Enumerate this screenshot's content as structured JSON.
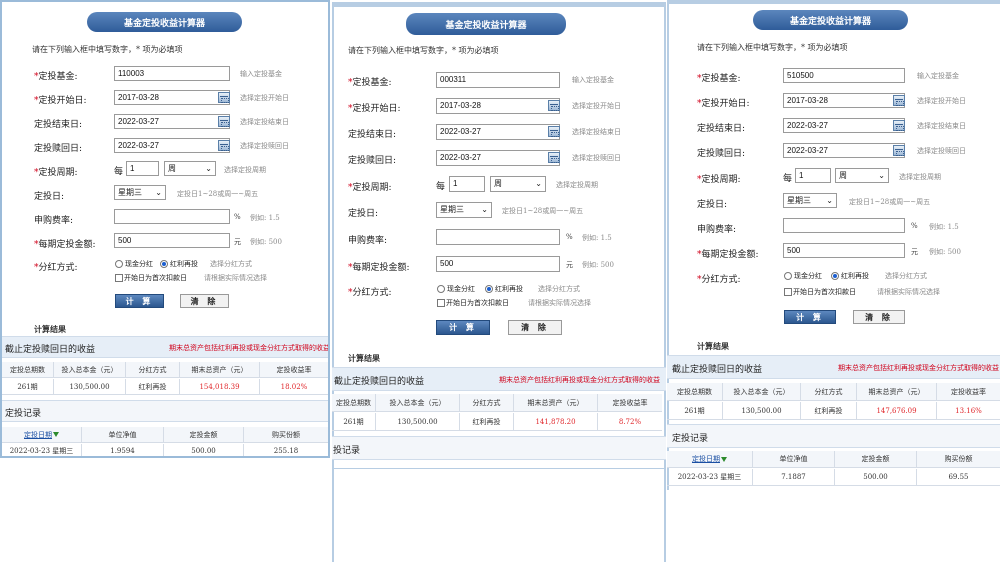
{
  "title": "基金定投收益计算器",
  "instruction": "请在下列输入框中填写数字，* 项为必填项",
  "labels": {
    "fund": "定投基金:",
    "start": "定投开始日:",
    "end": "定投结束日:",
    "redeem": "定投赎回日:",
    "period": "定投周期:",
    "day": "定投日:",
    "fee": "申购费率:",
    "amount": "每期定投金额:",
    "dividend": "分红方式:"
  },
  "hints": {
    "fund": "输入定投基金",
    "start": "选择定投开始日",
    "end": "选择定投结束日",
    "redeem": "选择定投赎回日",
    "period": "选择定投周期",
    "day": "定投日1~28或周一~周五",
    "fee": "例如: 1.5",
    "amount": "例如: 500",
    "dividend": "选择分红方式",
    "first_deduct": "请根据实际情况选择"
  },
  "units": {
    "fee": "%",
    "amount": "元"
  },
  "every": "每",
  "period_unit": "周",
  "weekday": "星期三",
  "radio_cash": "现金分红",
  "radio_reinvest": "红利再投",
  "first_deduct_label": "开始日为首次扣款日",
  "buttons": {
    "calc": "计 算",
    "clear": "清 除"
  },
  "result_title": "计算结果",
  "section_income": "截止定投赎回日的收益",
  "section_note": "期末总资产包括红利再投或现金分红方式取得的收益",
  "section_records": "定投记录",
  "summary_headers": [
    "定投总期数",
    "投入总本金（元）",
    "分红方式",
    "期末总资产（元）",
    "定投收益率"
  ],
  "record_headers": [
    "定投日期",
    "单位净值",
    "定投金额",
    "购买份额"
  ],
  "panels": [
    {
      "fund": "110003",
      "start": "2017-03-28",
      "end": "2022-03-27",
      "redeem": "2022-03-27",
      "period_num": "1",
      "amount": "500",
      "summary": [
        "261期",
        "130,500.00",
        "红利再投",
        "154,018.39",
        "18.02%"
      ],
      "record": [
        "2022-03-23 星期三",
        "1.9594",
        "500.00",
        "255.18"
      ]
    },
    {
      "fund": "000311",
      "start": "2017-03-28",
      "end": "2022-03-27",
      "redeem": "2022-03-27",
      "period_num": "1",
      "amount": "500",
      "summary": [
        "261期",
        "130,500.00",
        "红利再投",
        "141,878.20",
        "8.72%"
      ],
      "section_records_partial": "投记录"
    },
    {
      "fund": "510500",
      "start": "2017-03-28",
      "end": "2022-03-27",
      "redeem": "2022-03-27",
      "period_num": "1",
      "amount": "500",
      "summary": [
        "261期",
        "130,500.00",
        "红利再投",
        "147,676.09",
        "13.16%"
      ],
      "record": [
        "2022-03-23 星期三",
        "7.1887",
        "500.00",
        "69.55"
      ]
    }
  ],
  "colors": {
    "accent": "#2f5c99",
    "negative_red": "#e0262a",
    "required": "#d0021b"
  }
}
